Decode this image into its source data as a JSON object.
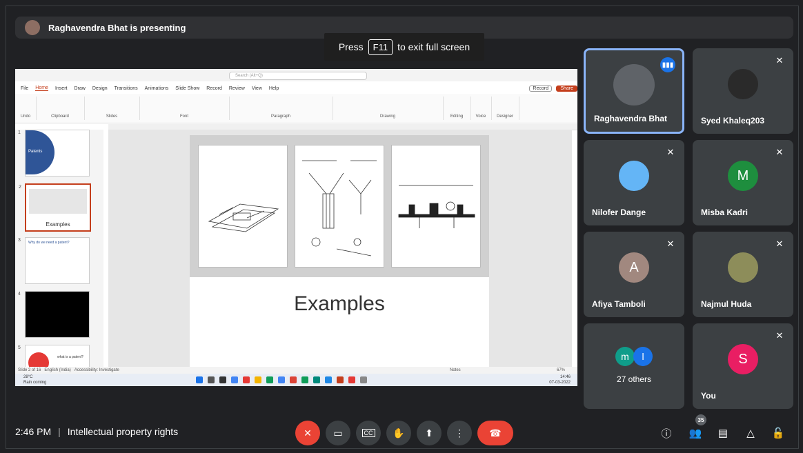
{
  "presenter_banner": {
    "text": "Raghavendra Bhat is presenting"
  },
  "fullscreen_hint": {
    "prefix": "Press",
    "key": "F11",
    "suffix": "to exit full screen"
  },
  "powerpoint": {
    "search_placeholder": "Search (Alt+Q)",
    "tabs": [
      "File",
      "Home",
      "Insert",
      "Draw",
      "Design",
      "Transitions",
      "Animations",
      "Slide Show",
      "Record",
      "Review",
      "View",
      "Help"
    ],
    "record_label": "Record",
    "share_label": "Share",
    "ribbon_groups": [
      "Undo",
      "Clipboard",
      "Slides",
      "Font",
      "Paragraph",
      "Drawing",
      "Editing",
      "Voice",
      "Designer"
    ],
    "thumbnails": [
      {
        "num": "1",
        "caption": "Patents"
      },
      {
        "num": "2",
        "caption": "Examples"
      },
      {
        "num": "3",
        "caption": "Why do we need a patent?"
      },
      {
        "num": "4",
        "caption": ""
      },
      {
        "num": "5",
        "caption": "what is a patent?"
      }
    ],
    "slide_title": "Examples",
    "status_left": "Slide 2 of 16",
    "status_lang": "English (India)",
    "status_access": "Accessibility: Investigate",
    "status_notes": "Notes",
    "zoom": "67%",
    "weather": "28°C",
    "weather_sub": "Rain coming",
    "clock_time": "14:46",
    "clock_date": "07-03-2022"
  },
  "participants": [
    {
      "name": "Raghavendra Bhat",
      "speaking": true,
      "avatar_color": "#5f6368"
    },
    {
      "name": "Syed Khaleq203",
      "muted": true,
      "avatar_color": "#2a2a2a"
    },
    {
      "name": "Nilofer Dange",
      "muted": true,
      "avatar_color": "#64b5f6"
    },
    {
      "name": "Misba Kadri",
      "muted": true,
      "initial": "M",
      "avatar_color": "#1e8e3e"
    },
    {
      "name": "Afiya Tamboli",
      "muted": true,
      "initial": "A",
      "avatar_color": "#a1887f"
    },
    {
      "name": "Najmul Huda",
      "muted": true,
      "avatar_color": "#8d8d5a"
    },
    {
      "name": "27 others",
      "initials": [
        "m",
        "l"
      ],
      "avatar_colors": [
        "#0f9d8a",
        "#1a73e8"
      ]
    },
    {
      "name": "You",
      "muted": true,
      "initial": "S",
      "avatar_color": "#e91e63"
    }
  ],
  "footer": {
    "time": "2:46 PM",
    "meeting_title": "Intellectual property rights",
    "participant_count": "35"
  }
}
